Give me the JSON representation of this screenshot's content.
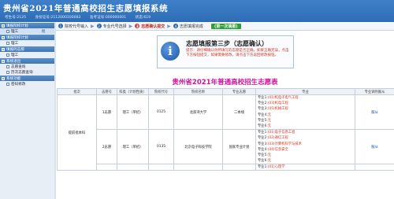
{
  "header": {
    "title": "贵州省2021年普通高校招生志愿填报系统",
    "info": [
      "考生号:2125",
      "身份证号:2112000100083",
      "准考证号:000000001",
      "状态:619"
    ]
  },
  "sidebar": {
    "groups": [
      {
        "title": "填报院校计划",
        "items": [
          {
            "label": "理工",
            "extra": "批"
          }
        ]
      },
      {
        "title": "填报院校计划",
        "items": [
          {
            "label": "理工"
          }
        ]
      },
      {
        "title": "填报的志愿",
        "items": [
          {
            "label": "理工"
          }
        ]
      },
      {
        "title": "系统退出",
        "items": [
          {
            "label": "志愿查询"
          },
          {
            "label": "历次志愿查询"
          }
        ]
      },
      {
        "title": "系统功能",
        "items": [
          {
            "label": "密码修改"
          }
        ]
      }
    ]
  },
  "steps": [
    {
      "num": "1",
      "label": "院校代号输入"
    },
    {
      "num": "2",
      "label": "专业代号选择"
    },
    {
      "num": "3",
      "label": "志愿确认提交"
    },
    {
      "num": "4",
      "label": "志愿填报完成"
    }
  ],
  "current_round": "(第一次填报)",
  "notice": {
    "title": "志愿填报第三步（志愿确认）",
    "text": "提示：请仔细确认你所填写的志愿是否正确，如果正确无误，点击下方按钮提交，如果需要修改，请点击下方返回修改按钮。"
  },
  "table_title": "贵州省2021年普通高校招生志愿表",
  "table": {
    "headers": [
      "批次",
      "志愿号",
      "科类（计划性质）",
      "院校代号",
      "院校名称",
      "专业志愿",
      "专业",
      "专业调剂服从"
    ],
    "batch": "提前批本科",
    "rows": [
      {
        "no": "1志愿",
        "category": "理工（单招）",
        "code": "0125",
        "school": "北部湾大学",
        "specialty": "二本线",
        "majors": [
          {
            "idx": "专业1:",
            "name": "(01)机电子电气工程"
          },
          {
            "idx": "专业2:",
            "name": "(03)机电工程"
          },
          {
            "idx": "专业3:",
            "name": "(05)机械工程"
          },
          {
            "idx": "专业4:",
            "name": "无"
          },
          {
            "idx": "专业5:",
            "name": "无"
          },
          {
            "idx": "专业6:",
            "name": "无"
          }
        ],
        "adjust": "服从"
      },
      {
        "no": "2志愿",
        "category": "理工（单招）",
        "code": "0135",
        "school": "北京电子科技学院",
        "specialty": "国家专业计划",
        "majors": [
          {
            "idx": "专业1:",
            "name": "(01)电子信息工程"
          },
          {
            "idx": "专业2:",
            "name": "(02)通信工程"
          },
          {
            "idx": "专业3:",
            "name": "(03)计算机科学与技术"
          },
          {
            "idx": "专业4:",
            "name": "(04)信息安全"
          },
          {
            "idx": "专业5:",
            "name": "无"
          },
          {
            "idx": "专业6:",
            "name": "无"
          }
        ],
        "adjust": "服从"
      },
      {
        "no": "",
        "category": "",
        "code": "",
        "school": "",
        "specialty": "",
        "majors": [
          {
            "idx": "专业1:",
            "name": "(01)心理学"
          }
        ],
        "adjust": ""
      }
    ]
  },
  "colors": {
    "header": "#2e6db5",
    "accent_red": "#d62f1c",
    "table_title": "#d0139e",
    "current_round": "#2f9e3a"
  }
}
